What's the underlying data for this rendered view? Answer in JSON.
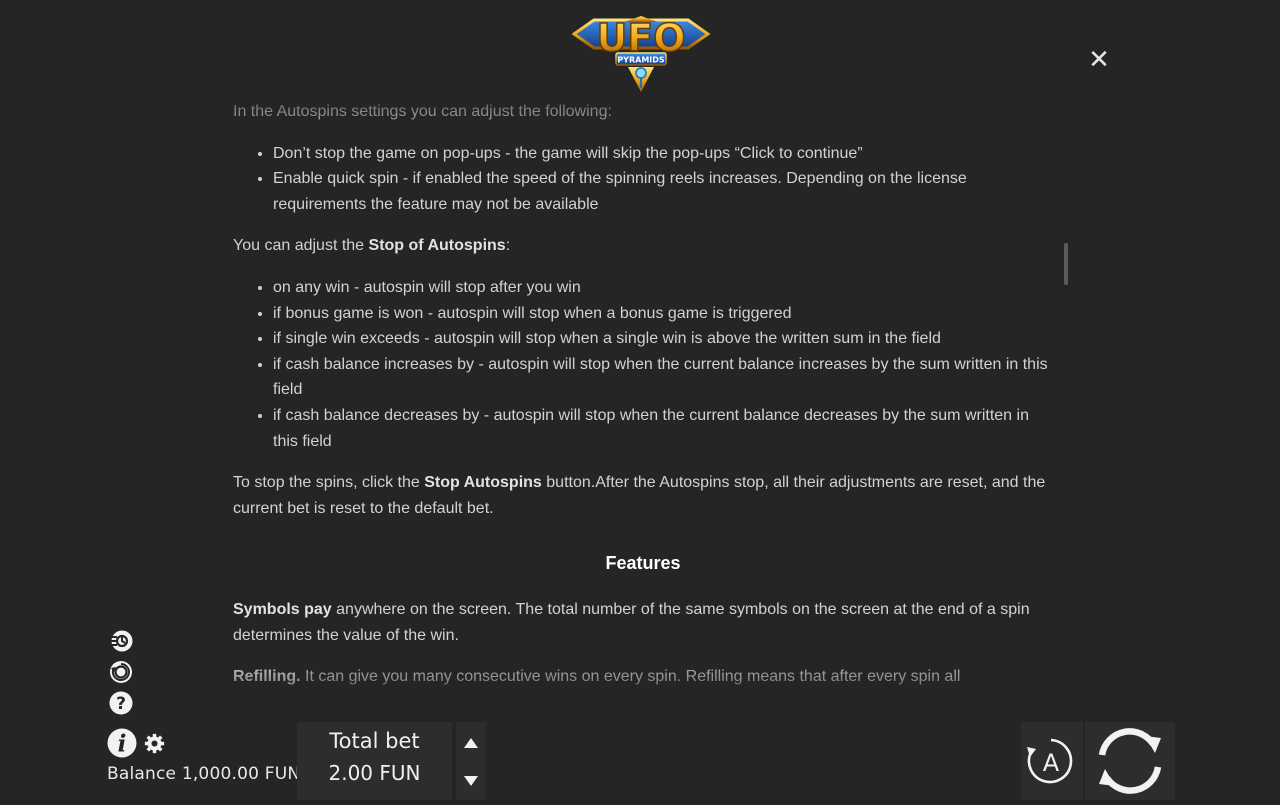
{
  "logo": {
    "word": "UFO",
    "sub": "PYRAMIDS"
  },
  "close_icon": "✕",
  "help": {
    "intro_text": "In the Autospins settings you can adjust the following:",
    "settings_items": [
      "Don’t stop the game on pop-ups - the game will skip the pop-ups “Click to continue”",
      "Enable quick spin - if enabled the speed of the spinning reels increases. Depending on the license requirements the feature may not be available"
    ],
    "stop_prefix": "You can adjust the ",
    "stop_bold": "Stop of Autospins",
    "stop_suffix": ":",
    "stop_items": [
      "on any win - autospin will stop after you win",
      "if bonus game is won - autospin will stop when a bonus game is triggered",
      "if single win exceeds - autospin will stop when a single win is above the written sum in the field",
      "if cash balance increases by - autospin will stop when the current balance increases by the sum written in this field",
      "if cash balance decreases by - autospin will stop when the current balance decreases by the sum written in this field"
    ],
    "stop_spins_prefix": "To stop the spins, click the ",
    "stop_spins_bold": "Stop Autospins",
    "stop_spins_suffix": " button.After the Autospins stop, all their adjustments are reset, and the current bet is reset to the default bet.",
    "features_heading": "Features",
    "symbols_bold": "Symbols pay",
    "symbols_text": " anywhere on the screen. The total number of the same symbols on the screen at the end of a spin determines the value of the win.",
    "refilling_bold": "Refilling.",
    "refilling_text": " It can give you many consecutive wins on every spin. Refilling means that after every spin all"
  },
  "footer": {
    "balance_label": "Balance",
    "balance_value": "1,000.00 FUN",
    "total_bet_label": "Total bet",
    "total_bet_value": "2.00 FUN",
    "auto_label": "A"
  },
  "icons": {
    "quick_spin": "quick-spin-icon",
    "autoplay": "autoplay-settings-icon",
    "help": "help-icon",
    "info": "info-icon",
    "settings": "gear-icon",
    "bet_up": "bet-increase-icon",
    "bet_down": "bet-decrease-icon",
    "spin": "spin-icon"
  },
  "colors": {
    "background": "#252525",
    "panel": "#2d2d2d",
    "text": "#d2d2d2",
    "logo_gold": "#e8a416",
    "logo_blue": "#1f4fa8"
  }
}
